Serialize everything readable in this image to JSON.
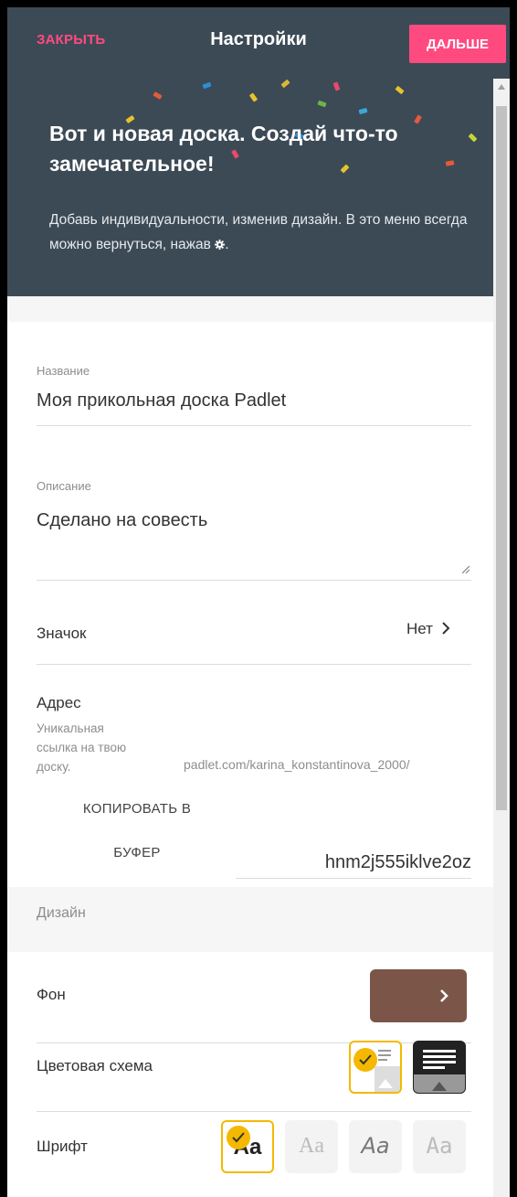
{
  "header": {
    "close_label": "ЗАКРЫТЬ",
    "title": "Настройки",
    "next_label": "ДАЛЬШЕ"
  },
  "hero": {
    "title": "Вот и новая доска. Создай что-то замечательное!",
    "text": "Добавь индивидуальности, изменив дизайн. В это меню всегда можно вернуться, нажав",
    "text_end": "."
  },
  "fields": {
    "title_label": "Название",
    "title_value": "Моя прикольная доска Padlet",
    "description_label": "Описание",
    "description_value": "Сделано на совесть",
    "icon_label": "Значок",
    "icon_value": "Нет",
    "address_label": "Адрес",
    "address_hint": "Уникальная ссылка на твою доску.",
    "address_prefix": "padlet.com/karina_konstantinova_2000/",
    "address_value": "hnm2j555iklve2oz",
    "copy_label": "КОПИРОВАТЬ В БУФЕР"
  },
  "design": {
    "section_label": "Дизайн",
    "background_label": "Фон",
    "background_color": "#7b5648",
    "scheme_label": "Цветовая схема",
    "font_label": "Шрифт",
    "font_sample": "Aa"
  },
  "colors": {
    "accent": "#ff4a80",
    "header_bg": "#3c4a55",
    "selection": "#f5b800"
  }
}
